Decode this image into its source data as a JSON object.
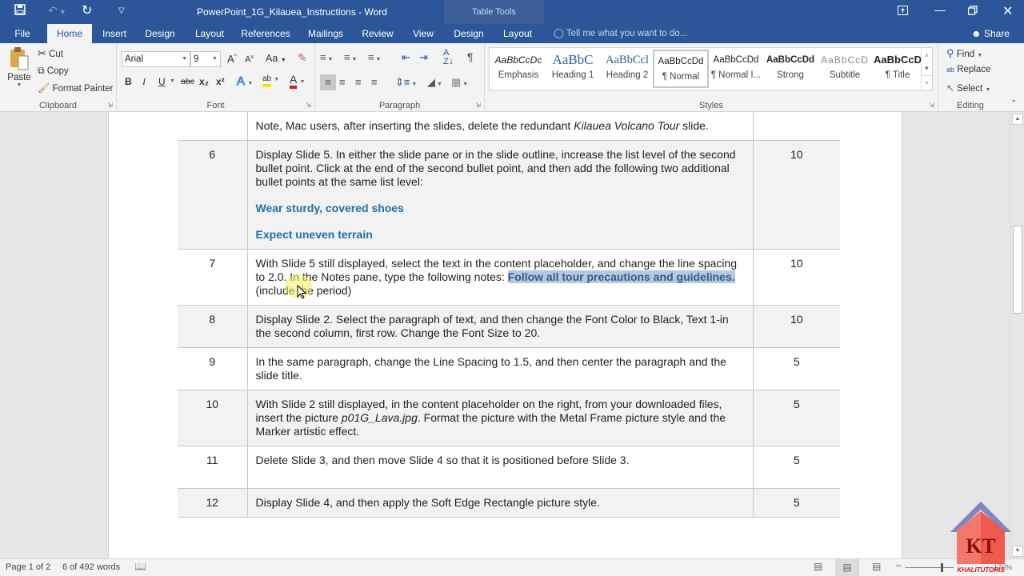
{
  "window": {
    "title": "PowerPoint_1G_Kilauea_Instructions - Word",
    "contextual_tab_group": "Table Tools",
    "quick_access": [
      "save-icon",
      "undo-icon",
      "redo-icon",
      "customize-qat-icon"
    ],
    "controls": [
      "ribbon-display-options-icon",
      "minimize-icon",
      "restore-icon",
      "close-icon"
    ]
  },
  "tabs": [
    {
      "label": "File"
    },
    {
      "label": "Home",
      "active": true
    },
    {
      "label": "Insert"
    },
    {
      "label": "Design"
    },
    {
      "label": "Layout"
    },
    {
      "label": "References"
    },
    {
      "label": "Mailings"
    },
    {
      "label": "Review"
    },
    {
      "label": "View"
    },
    {
      "label": "Design"
    },
    {
      "label": "Layout"
    }
  ],
  "tell_me": {
    "placeholder": "Tell me what you want to do..."
  },
  "share_label": "Share",
  "ribbon": {
    "clipboard": {
      "label": "Clipboard",
      "paste": "Paste",
      "cut": "Cut",
      "copy": "Copy",
      "format_painter": "Format Painter"
    },
    "font": {
      "label": "Font",
      "font_name": "Arial",
      "font_size": "9",
      "grow": "A",
      "shrink": "A",
      "change_case": "Aa",
      "bold": "B",
      "italic": "I",
      "underline": "U",
      "strikethrough": "abc",
      "subscript": "x₂",
      "superscript": "x²",
      "text_effects": "A",
      "highlight": "ab",
      "font_color": "A",
      "highlight_color": "#f5e700",
      "font_color_value": "#d02020"
    },
    "paragraph": {
      "label": "Paragraph",
      "pilcrow": "¶"
    },
    "styles": {
      "label": "Styles",
      "items": [
        {
          "sample": "AaBbCcDc",
          "name": "Emphasis"
        },
        {
          "sample": "AaBbC",
          "name": "Heading 1"
        },
        {
          "sample": "AaBbCcl",
          "name": "Heading 2"
        },
        {
          "sample": "AaBbCcDd",
          "name": "¶ Normal",
          "selected": true
        },
        {
          "sample": "AaBbCcDd",
          "name": "¶ Normal I..."
        },
        {
          "sample": "AaBbCcDd",
          "name": "Strong"
        },
        {
          "sample": "AaBbCcD",
          "name": "Subtitle"
        },
        {
          "sample": "AaBbCcD",
          "name": "¶ Title"
        }
      ]
    },
    "editing": {
      "label": "Editing",
      "find": "Find",
      "replace": "Replace",
      "select": "Select"
    }
  },
  "document": {
    "rows": [
      {
        "num": "",
        "points": "",
        "text": "Note, Mac users, after inserting the slides, delete the redundant ",
        "italic": "Kilauea Volcano Tour",
        "after": " slide."
      },
      {
        "num": "6",
        "points": "10",
        "text": "Display Slide 5. In either the slide pane or in the slide outline, increase the list level of the second bullet point. Click at the end of the second bullet point, and then add the following two additional bullet points at the same list level:",
        "bullets": [
          "Wear sturdy, covered shoes",
          "Expect uneven terrain"
        ]
      },
      {
        "num": "7",
        "points": "10",
        "text_a": "With Slide 5 still displayed, select the text in the content placeholder, and change the line spacing to 2.0. In the Notes pane, type the following notes: ",
        "highlighted": "Follow all tour precautions and guidelines.",
        "text_b": " (include the period)"
      },
      {
        "num": "8",
        "points": "10",
        "text": "Display Slide 2. Select the paragraph of text, and then change the Font Color to Black, Text 1-in the second column, first row. Change the Font Size to 20."
      },
      {
        "num": "9",
        "points": "5",
        "text": "In the same paragraph, change the Line Spacing to 1.5, and then center the paragraph and the slide title."
      },
      {
        "num": "10",
        "points": "5",
        "text_a": "With Slide 2 still displayed, in the content placeholder on the right, from your downloaded files, insert the picture ",
        "italic": "p01G_Lava.jpg",
        "text_b": ". Format the picture with the Metal Frame picture style and the Marker artistic effect."
      },
      {
        "num": "11",
        "points": "5",
        "text": "Delete Slide 3, and then move Slide 4 so that it is positioned before Slide 3."
      },
      {
        "num": "12",
        "points": "5",
        "text": "Display Slide 4, and then apply the Soft Edge Rectangle picture style."
      }
    ]
  },
  "status": {
    "page": "Page 1 of 2",
    "words": "6 of 492 words",
    "proofing_icon": "proofing-icon",
    "zoom": "170%"
  },
  "watermark": {
    "letters": "KT",
    "text": "KHALITUTORIS"
  }
}
